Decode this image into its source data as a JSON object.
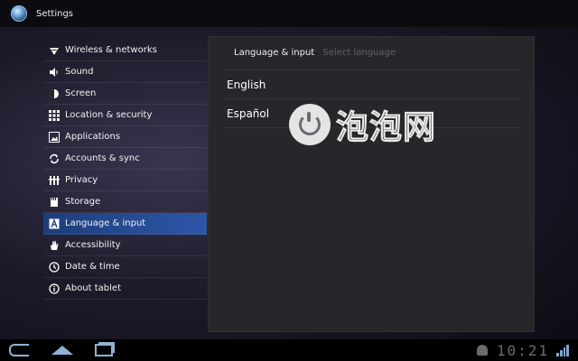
{
  "app": {
    "title": "Settings",
    "icon": "settings-app-icon"
  },
  "menu": {
    "items": [
      {
        "label": "Wireless & networks",
        "icon": "wifi-icon"
      },
      {
        "label": "Sound",
        "icon": "speaker-icon"
      },
      {
        "label": "Screen",
        "icon": "brightness-icon"
      },
      {
        "label": "Location & security",
        "icon": "grid-lock-icon"
      },
      {
        "label": "Applications",
        "icon": "apps-icon"
      },
      {
        "label": "Accounts & sync",
        "icon": "sync-icon"
      },
      {
        "label": "Privacy",
        "icon": "privacy-icon"
      },
      {
        "label": "Storage",
        "icon": "storage-icon"
      },
      {
        "label": "Language & input",
        "icon": "language-icon",
        "active": true
      },
      {
        "label": "Accessibility",
        "icon": "hand-icon"
      },
      {
        "label": "Date & time",
        "icon": "clock-icon"
      },
      {
        "label": "About tablet",
        "icon": "info-icon"
      }
    ]
  },
  "panel": {
    "title": "Language & input",
    "subtitle": "Select language",
    "options": [
      "English",
      "Español"
    ]
  },
  "watermark": {
    "text": "泡泡网"
  },
  "navbar": {
    "time": "10:21",
    "colors": {
      "nav": "#8fb3d6",
      "active": "#2c56a8"
    }
  }
}
